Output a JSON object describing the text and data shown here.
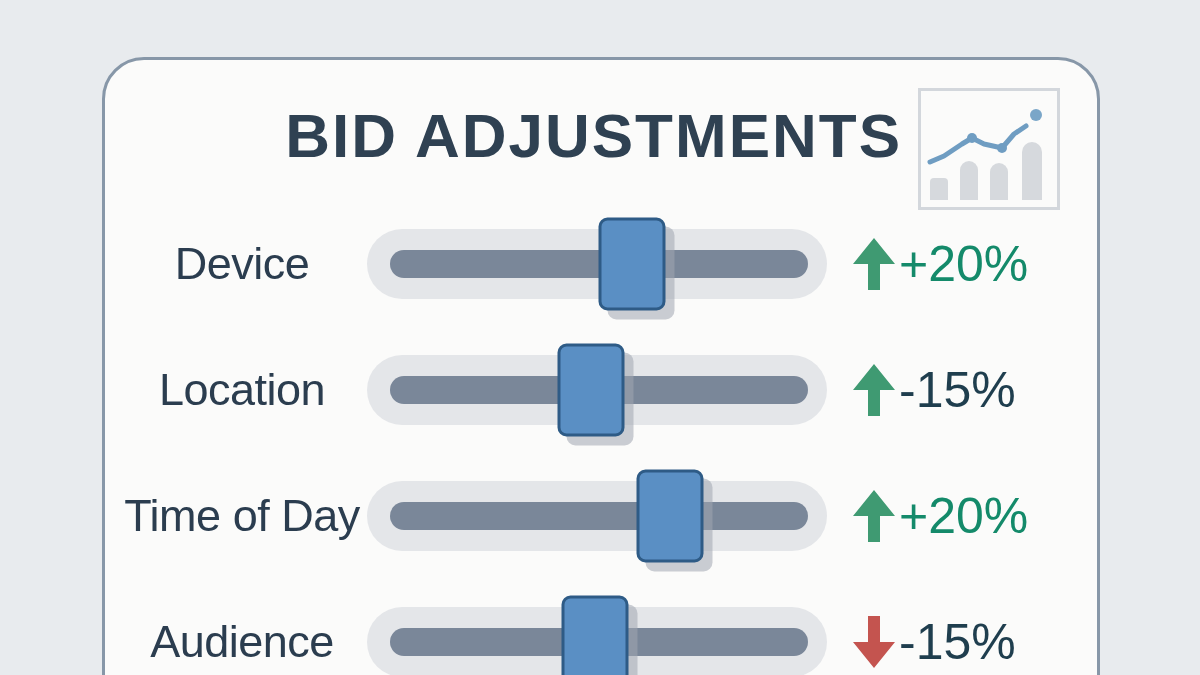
{
  "title": "BID ADJUSTMENTS",
  "rows": [
    {
      "label": "Device",
      "level": 0.58,
      "arrow_up": true,
      "value": "+20%",
      "positive": true
    },
    {
      "label": "Location",
      "level": 0.48,
      "arrow_up": true,
      "value": "-15%",
      "positive": false
    },
    {
      "label": "Time of Day",
      "level": 0.67,
      "arrow_up": true,
      "value": "+20%",
      "positive": true
    },
    {
      "label": "Audience",
      "level": 0.49,
      "arrow_up": false,
      "value": "-15%",
      "positive": false
    }
  ]
}
